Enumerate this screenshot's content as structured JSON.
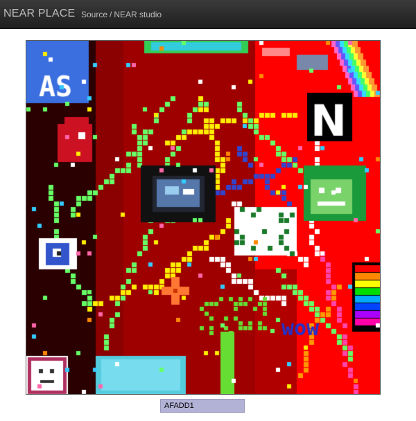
{
  "nav": {
    "brand": "NEAR PLACE",
    "links": [
      {
        "label": "Source"
      },
      {
        "label": "NEAR studio"
      }
    ],
    "separator": "/"
  },
  "canvas": {
    "labels": [
      "AS",
      "N",
      "wow"
    ]
  },
  "color_field": {
    "value": "AFADD1"
  },
  "colors": {
    "nav_bg": "#2b2b2b",
    "nav_text": "#bdbdbd",
    "canvas_red": "#ff0000",
    "canvas_dark_red": "#8b0000",
    "input_bg": "#b2b1d6"
  }
}
